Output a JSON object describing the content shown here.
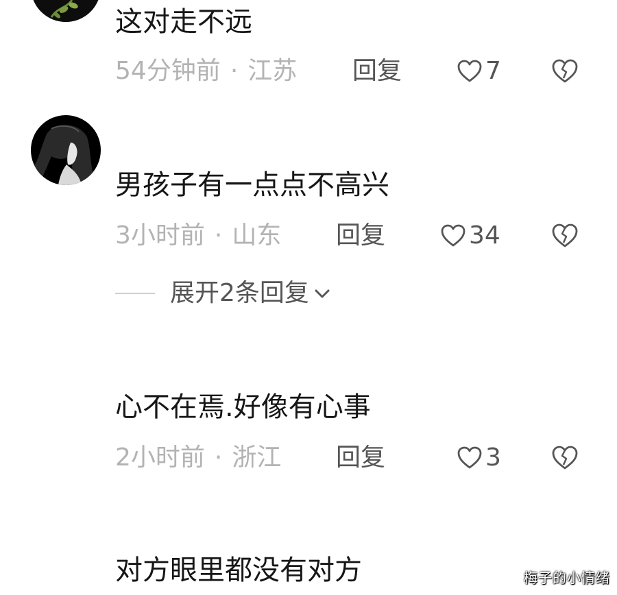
{
  "comments": [
    {
      "text": "这对走不远",
      "time": "54分钟前",
      "dot": "·",
      "location": "江苏",
      "reply_label": "回复",
      "likes": "7"
    },
    {
      "text": "男孩子有一点点不高兴",
      "time": "3小时前",
      "dot": "·",
      "location": "山东",
      "reply_label": "回复",
      "likes": "34",
      "expand_label": "展开2条回复"
    },
    {
      "text": "心不在焉.好像有心事",
      "time": "2小时前",
      "dot": "·",
      "location": "浙江",
      "reply_label": "回复",
      "likes": "3"
    },
    {
      "text": "对方眼里都没有对方"
    }
  ],
  "icons": {
    "like": "heart-outline-icon",
    "dislike": "broken-heart-icon",
    "expand": "chevron-down-icon"
  },
  "watermark": "梅子的小情绪",
  "colors": {
    "text": "#161616",
    "meta": "#b3b3b3",
    "action": "#555555"
  }
}
